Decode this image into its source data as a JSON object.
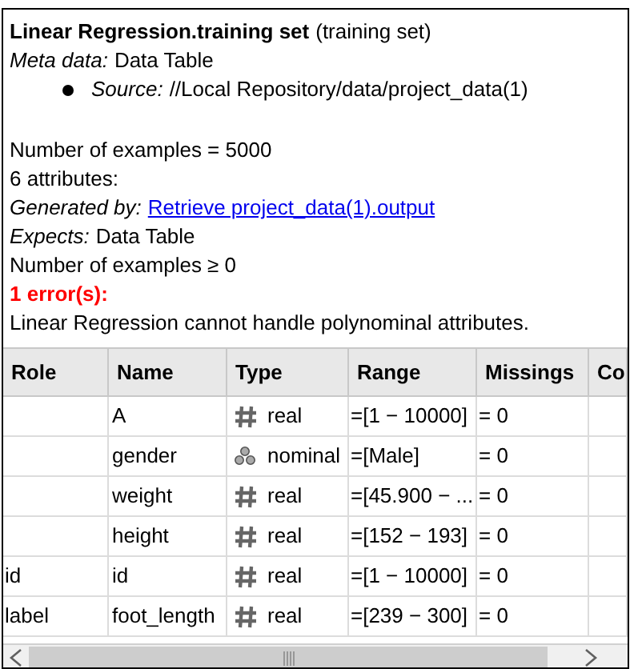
{
  "info": {
    "title": "Linear Regression.training set",
    "title_suffix": "(training set)",
    "meta": {
      "label": "Meta data:",
      "value": "Data Table"
    },
    "source": {
      "label": "Source:",
      "value": "//Local Repository/data/project_data(1)"
    },
    "examples": "Number of examples = 5000",
    "attributes": "6 attributes:",
    "generated": {
      "label": "Generated by:",
      "link": "Retrieve project_data(1).output"
    },
    "expects": {
      "label": "Expects:",
      "value": "Data Table"
    },
    "constraint": "Number of examples ≥ 0",
    "error_title": "1 error(s):",
    "error_message": "Linear Regression cannot handle polynominal attributes."
  },
  "table": {
    "columns": [
      "Role",
      "Name",
      "Type",
      "Range",
      "Missings",
      "Co"
    ],
    "rows": [
      {
        "role": "",
        "name": "A",
        "kind": "real",
        "type": "real",
        "range": "=[1 − 10000]",
        "missings": "= 0"
      },
      {
        "role": "",
        "name": "gender",
        "kind": "nominal",
        "type": "nominal",
        "range": "=[Male]",
        "missings": "= 0"
      },
      {
        "role": "",
        "name": "weight",
        "kind": "real",
        "type": "real",
        "range": "=[45.900 − ...",
        "missings": "= 0"
      },
      {
        "role": "",
        "name": "height",
        "kind": "real",
        "type": "real",
        "range": "=[152 − 193]",
        "missings": "= 0"
      },
      {
        "role": "id",
        "name": "id",
        "kind": "real",
        "type": "real",
        "range": "=[1 − 10000]",
        "missings": "= 0"
      },
      {
        "role": "label",
        "name": "foot_length",
        "kind": "real",
        "type": "real",
        "range": "=[239 − 300]",
        "missings": "= 0"
      }
    ]
  }
}
